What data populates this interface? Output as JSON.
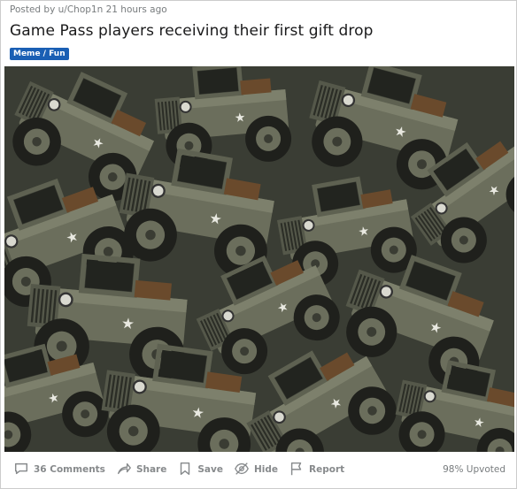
{
  "post": {
    "meta": "Posted by u/Chop1n 21 hours ago",
    "title": "Game Pass players receiving their first gift drop",
    "flair": "Meme / Fun",
    "flair_color": "#1a5fb4",
    "image_description": "pile of many olive-drab military jeeps"
  },
  "actions": {
    "comments_label": "36 Comments",
    "share_label": "Share",
    "save_label": "Save",
    "hide_label": "Hide",
    "report_label": "Report",
    "upvoted_text": "98% Upvoted"
  },
  "icons": {
    "comments": "comment-icon",
    "share": "share-icon",
    "save": "bookmark-icon",
    "hide": "eye-slash-icon",
    "report": "flag-icon"
  }
}
